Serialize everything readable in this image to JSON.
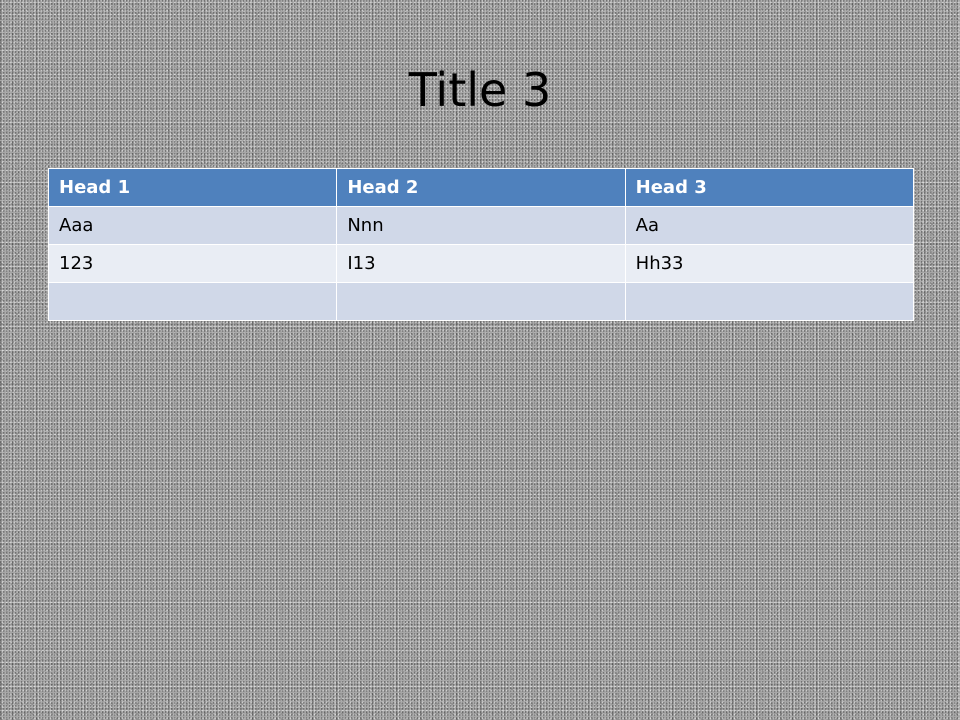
{
  "slide": {
    "title": "Title 3"
  },
  "table": {
    "headers": [
      "Head 1",
      "Head 2",
      "Head 3"
    ],
    "rows": [
      [
        "Aaa",
        "Nnn",
        "Aa"
      ],
      [
        "123",
        "I13",
        "Hh33"
      ],
      [
        "",
        "",
        ""
      ]
    ],
    "colors": {
      "header_bg": "#4f81bd",
      "row_band_1": "#d0d8e8",
      "row_band_2": "#e9edf4"
    }
  }
}
